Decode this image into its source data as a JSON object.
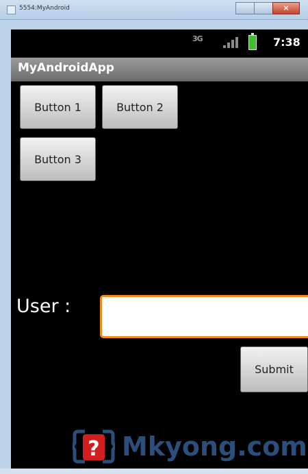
{
  "window": {
    "title": "5554:MyAndroid"
  },
  "statusbar": {
    "data_indicator": "3G",
    "time": "7:38"
  },
  "appbar": {
    "title": "MyAndroidApp"
  },
  "buttons": {
    "button1": "Button 1",
    "button2": "Button 2",
    "button3": "Button 3"
  },
  "form": {
    "user_label": "User :",
    "user_value": "",
    "submit_label": "Submit"
  },
  "watermark": {
    "text": "Mkyong.com"
  },
  "colors": {
    "accent": "#f08a1c",
    "screen_bg": "#000000",
    "appbar": "#8a8a8a",
    "battery": "#3fbf2f"
  }
}
